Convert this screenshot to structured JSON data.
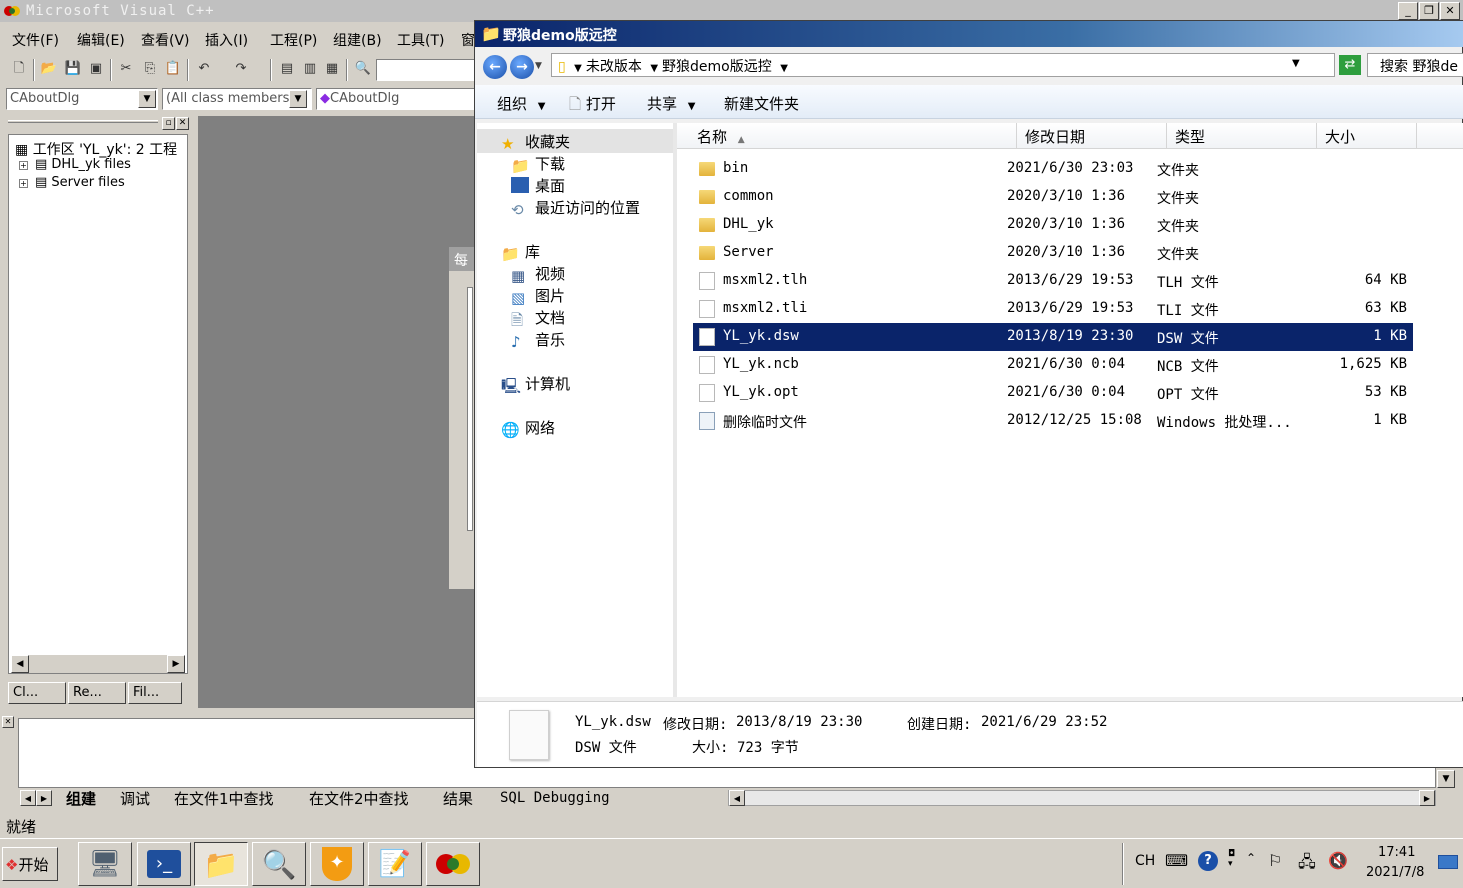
{
  "vc": {
    "title": "Microsoft Visual C++",
    "menu": [
      "文件(F)",
      "编辑(E)",
      "查看(V)",
      "插入(I)",
      "工程(P)",
      "组建(B)",
      "工具(T)",
      "窗"
    ],
    "combos": {
      "class": "CAboutDlg",
      "members": "(All class members)",
      "function": "CAboutDlg"
    },
    "workspace": {
      "root": "工作区 'YL_yk': 2 工程",
      "items": [
        "DHL_yk files",
        "Server files"
      ],
      "tabs": [
        "Cl...",
        "Re...",
        "Fil..."
      ]
    },
    "output_tabs": [
      "组建",
      "调试",
      "在文件1中查找",
      "在文件2中查找",
      "结果",
      "SQL Debugging"
    ],
    "status": "就绪",
    "ghost_label": "每"
  },
  "explorer": {
    "title": "野狼demo版远控",
    "breadcrumb": [
      "未改版本",
      "野狼demo版远控"
    ],
    "search_placeholder": "搜索 野狼de",
    "commands": {
      "organize": "组织",
      "open": "打开",
      "share": "共享",
      "new_folder": "新建文件夹"
    },
    "nav": {
      "favorites": "收藏夹",
      "favorites_items": [
        "下载",
        "桌面",
        "最近访问的位置"
      ],
      "libraries": "库",
      "library_items": [
        "视频",
        "图片",
        "文档",
        "音乐"
      ],
      "computer": "计算机",
      "network": "网络"
    },
    "columns": [
      "名称",
      "修改日期",
      "类型",
      "大小"
    ],
    "files": [
      {
        "name": "bin",
        "date": "2021/6/30 23:03",
        "type": "文件夹",
        "size": "",
        "kind": "folder"
      },
      {
        "name": "common",
        "date": "2020/3/10 1:36",
        "type": "文件夹",
        "size": "",
        "kind": "folder"
      },
      {
        "name": "DHL_yk",
        "date": "2020/3/10 1:36",
        "type": "文件夹",
        "size": "",
        "kind": "folder"
      },
      {
        "name": "Server",
        "date": "2020/3/10 1:36",
        "type": "文件夹",
        "size": "",
        "kind": "folder"
      },
      {
        "name": "msxml2.tlh",
        "date": "2013/6/29 19:53",
        "type": "TLH 文件",
        "size": "64 KB",
        "kind": "file"
      },
      {
        "name": "msxml2.tli",
        "date": "2013/6/29 19:53",
        "type": "TLI 文件",
        "size": "63 KB",
        "kind": "file"
      },
      {
        "name": "YL_yk.dsw",
        "date": "2013/8/19 23:30",
        "type": "DSW 文件",
        "size": "1 KB",
        "kind": "file",
        "selected": true
      },
      {
        "name": "YL_yk.ncb",
        "date": "2021/6/30 0:04",
        "type": "NCB 文件",
        "size": "1,625 KB",
        "kind": "file"
      },
      {
        "name": "YL_yk.opt",
        "date": "2021/6/30 0:04",
        "type": "OPT 文件",
        "size": "53 KB",
        "kind": "file"
      },
      {
        "name": "删除临时文件",
        "date": "2012/12/25 15:08",
        "type": "Windows 批处理...",
        "size": "1 KB",
        "kind": "batch"
      }
    ],
    "details": {
      "name": "YL_yk.dsw",
      "modified_label": "修改日期:",
      "modified": "2013/8/19 23:30",
      "created_label": "创建日期:",
      "created": "2021/6/29 23:52",
      "type": "DSW 文件",
      "size_label": "大小:",
      "size": "723 字节"
    }
  },
  "taskbar": {
    "start": "开始",
    "lang": "CH",
    "time": "17:41",
    "date": "2021/7/8"
  }
}
